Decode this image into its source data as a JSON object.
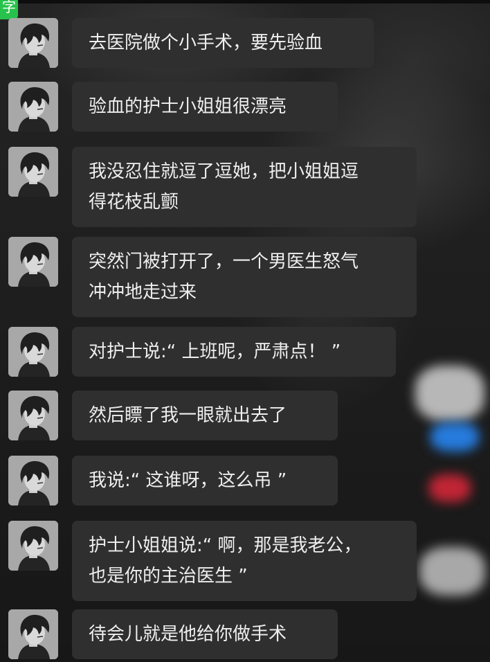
{
  "corner_tag": {
    "label": "字"
  },
  "messages": [
    {
      "lines": [
        "去医院做个小手术，要先验血"
      ]
    },
    {
      "lines": [
        "验血的护士小姐姐很漂亮"
      ]
    },
    {
      "lines": [
        "我没忍住就逗了逗她，把小姐姐逗",
        "得花枝乱颤"
      ]
    },
    {
      "lines": [
        "突然门被打开了，一个男医生怒气",
        "冲冲地走过来"
      ]
    },
    {
      "lines": [
        "对护士说:“ 上班呢，严肃点！ ”"
      ]
    },
    {
      "lines": [
        "然后瞟了我一眼就出去了"
      ]
    },
    {
      "lines": [
        "我说:“ 这谁呀，这么吊 ”"
      ]
    },
    {
      "lines": [
        "护士小姐姐说:“ 啊，那是我老公，",
        "也是你的主治医生 ”"
      ]
    },
    {
      "lines": [
        "待会儿就是他给你做手术"
      ]
    }
  ],
  "colors": {
    "bubble": "#2f2f2f",
    "text": "#efefef",
    "corner_tag": "#27c24c",
    "background": "#1b1b1b"
  },
  "icons": {
    "avatar": "anime-boy-dark-hair-avatar-icon"
  }
}
